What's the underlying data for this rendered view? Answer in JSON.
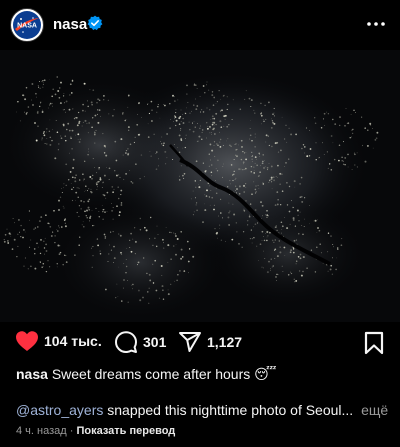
{
  "post": {
    "username": "nasa",
    "verified": true,
    "avatar_icon": "nasa-meatball-logo",
    "photo_alt": "nighttime satellite photo of a city",
    "likes": "104 тыс.",
    "comments": "301",
    "shares": "1,127",
    "caption_user": "nasa",
    "caption_text": "Sweet dreams come after hours",
    "caption_emoji": "😴",
    "description_mention": "@astro_ayers",
    "description_text": "snapped this nighttime photo of Seoul...",
    "more_label": "ещё",
    "time_ago": "4 ч. назад",
    "separator": "·",
    "translate_label": "Показать перевод"
  },
  "colors": {
    "background": "#000000",
    "like_red": "#ff3040",
    "verified_blue": "#0095f6",
    "mention": "#9fb3d8",
    "muted": "#9a9a9a"
  }
}
